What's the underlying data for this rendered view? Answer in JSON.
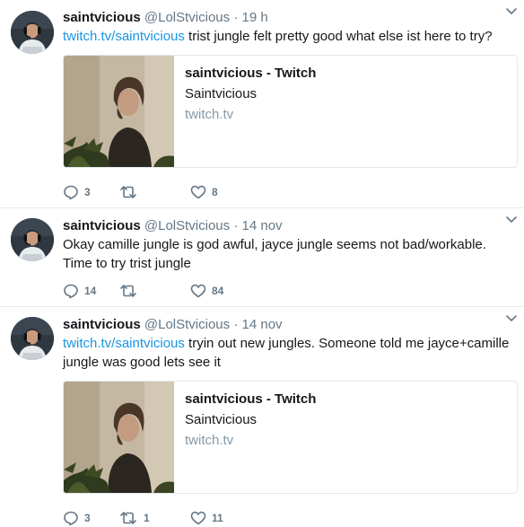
{
  "tweets": [
    {
      "name": "saintvicious",
      "handle": "@LolStvicious",
      "separator": "·",
      "time": "19 h",
      "link": "twitch.tv/saintvicious",
      "text": " trist jungle felt pretty good what else ist here to try?",
      "card": {
        "title": "saintvicious - Twitch",
        "description": "Saintvicious",
        "domain": "twitch.tv"
      },
      "replies": "3",
      "retweets": "",
      "likes": "8"
    },
    {
      "name": "saintvicious",
      "handle": "@LolStvicious",
      "separator": "·",
      "time": "14 nov",
      "text": "Okay camille jungle is god awful, jayce jungle seems not bad/workable.  Time to try trist jungle",
      "replies": "14",
      "retweets": "",
      "likes": "84"
    },
    {
      "name": "saintvicious",
      "handle": "@LolStvicious",
      "separator": "·",
      "time": "14 nov",
      "link": "twitch.tv/saintvicious",
      "text": " tryin out new jungles.  Someone told me jayce+camille jungle was good lets see it",
      "card": {
        "title": "saintvicious - Twitch",
        "description": "Saintvicious",
        "domain": "twitch.tv"
      },
      "replies": "3",
      "retweets": "1",
      "likes": "11"
    }
  ],
  "icons": {
    "reply": "reply-icon",
    "retweet": "retweet-icon",
    "like": "heart-icon",
    "menu": "chevron-down-icon"
  },
  "colors": {
    "link": "#1b95e0",
    "secondary": "#657786",
    "divider": "#e6ecf0"
  }
}
